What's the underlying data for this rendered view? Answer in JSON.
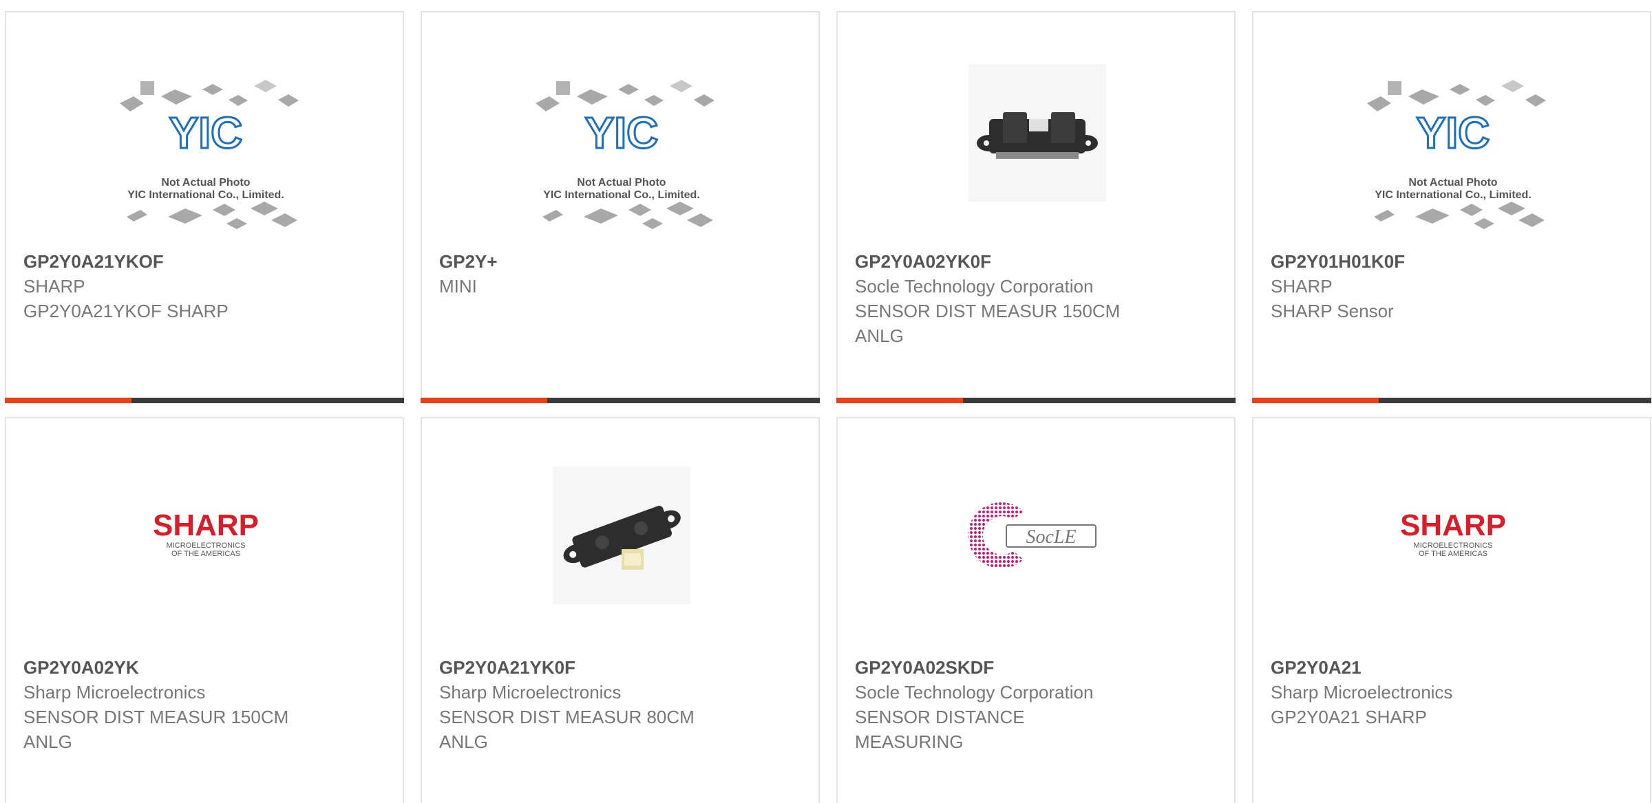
{
  "colors": {
    "accent": "#e8411b",
    "bar": "#3a3a3a",
    "border": "#e3e3e3",
    "title_text": "#555555",
    "body_text": "#777777",
    "sharp_red": "#d71f2b",
    "socle_pink": "#d4147a"
  },
  "products": [
    {
      "part": "GP2Y0A21YKOF",
      "maker": "SHARP",
      "desc_lines": [
        "GP2Y0A21YKOF SHARP"
      ],
      "image": "placeholder-photo",
      "placeholder": {
        "brand": "YIC",
        "line1": "Not Actual Photo",
        "line2": "YIC International Co., Limited."
      }
    },
    {
      "part": "GP2Y+",
      "maker": "MINI",
      "desc_lines": [],
      "image": "placeholder-photo",
      "placeholder": {
        "brand": "YIC",
        "line1": "Not Actual Photo",
        "line2": "YIC International Co., Limited."
      }
    },
    {
      "part": "GP2Y0A02YK0F",
      "maker": "Socle Technology Corporation",
      "desc_lines": [
        "SENSOR DIST MEASUR 150CM",
        "ANLG"
      ],
      "image": "sensor-photo-front"
    },
    {
      "part": "GP2Y01H01K0F",
      "maker": "SHARP",
      "desc_lines": [
        "SHARP Sensor"
      ],
      "image": "placeholder-photo",
      "placeholder": {
        "brand": "YIC",
        "line1": "Not Actual Photo",
        "line2": "YIC International Co., Limited."
      }
    },
    {
      "part": "GP2Y0A02YK",
      "maker": "Sharp Microelectronics",
      "desc_lines": [
        "SENSOR DIST MEASUR 150CM",
        "ANLG"
      ],
      "image": "sharp-logo",
      "logo": {
        "word": "SHARP",
        "sub1": "MICROELECTRONICS",
        "sub2": "OF THE AMERICAS"
      }
    },
    {
      "part": "GP2Y0A21YK0F",
      "maker": "Sharp Microelectronics",
      "desc_lines": [
        "SENSOR DIST MEASUR 80CM",
        "ANLG"
      ],
      "image": "sensor-photo-angled"
    },
    {
      "part": "GP2Y0A02SKDF",
      "maker": "Socle Technology Corporation",
      "desc_lines": [
        "SENSOR DISTANCE",
        "MEASURING"
      ],
      "image": "socle-logo",
      "logo": {
        "word": "SocLE"
      }
    },
    {
      "part": "GP2Y0A21",
      "maker": "Sharp Microelectronics",
      "desc_lines": [
        "GP2Y0A21 SHARP"
      ],
      "image": "sharp-logo",
      "logo": {
        "word": "SHARP",
        "sub1": "MICROELECTRONICS",
        "sub2": "OF THE AMERICAS"
      }
    }
  ]
}
